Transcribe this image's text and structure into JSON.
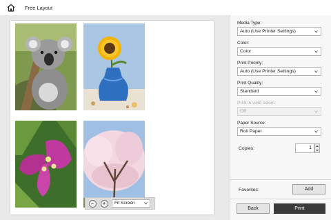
{
  "app": {
    "title": "Free Layout",
    "home_icon": "home-icon"
  },
  "preview": {
    "photos": [
      "koala-photo",
      "sunflower-vase-photo",
      "bougainvillea-flower-photo",
      "cherry-blossom-tree-photo"
    ],
    "zoom": {
      "zoom_out_icon": "zoom-out-icon",
      "zoom_in_icon": "zoom-in-icon",
      "fit_value": "Fit Screen"
    }
  },
  "settings": {
    "media_type": {
      "label": "Media Type:",
      "value": "Auto (Use Printer Settings)"
    },
    "color": {
      "label": "Color:",
      "value": "Color"
    },
    "print_priority": {
      "label": "Print Priority:",
      "value": "Auto (Use Printer Settings)"
    },
    "print_quality": {
      "label": "Print Quality:",
      "value": "Standard"
    },
    "vivid_colors": {
      "label": "Print in vivid colors:",
      "value": "Off",
      "disabled": true
    },
    "paper_source": {
      "label": "Paper Source:",
      "value": "Roll Paper"
    },
    "copies": {
      "label": "Copies:",
      "value": "1"
    }
  },
  "favorites": {
    "label": "Favorites:",
    "add_label": "Add"
  },
  "footer": {
    "back_label": "Back",
    "print_label": "Print"
  },
  "colors": {
    "print_button": "#3a3a3a",
    "panel_bg": "#f7f7f7",
    "preview_bg": "#e9e9e9"
  }
}
